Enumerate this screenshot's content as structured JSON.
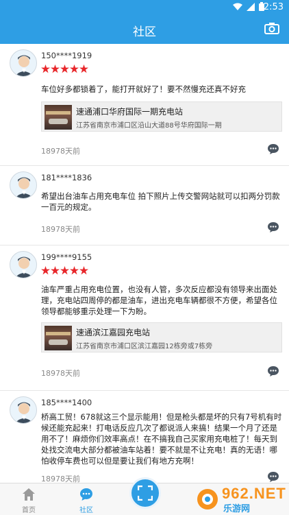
{
  "status_bar": {
    "time": "2:53"
  },
  "app_bar": {
    "title": "社区"
  },
  "posts": [
    {
      "user": "150****1919",
      "rating": 5,
      "content": "车位好多都锁着了，能打开就好了！要不然慢充还真不好充",
      "station": {
        "name": "速通浦口华府国际一期充电站",
        "address": "江苏省南京市浦口区沿山大道88号华府国际一期"
      },
      "time": "18978天前"
    },
    {
      "user": "181****1836",
      "rating": 0,
      "content": "希望出台油车占用充电车位 拍下照片上传交警网站就可以扣两分罚款一百元的规定。",
      "station": null,
      "time": "18978天前"
    },
    {
      "user": "199****9155",
      "rating": 5,
      "content": "油车严重占用充电位置，也没有人管，多次反应都没有领导来出面处理，充电站四周停的都是油车，进出充电车辆都很不方便，希望各位领导都能够重示处理一下为盼。",
      "station": {
        "name": "速通滨江嘉园充电站",
        "address": "江苏省南京市浦口区滨江嘉园12栋旁或7栋旁"
      },
      "time": "18978天前"
    },
    {
      "user": "185****1400",
      "rating": 0,
      "content": "桥高工贸！678就这三个显示能用！但是枪头都是坏的只有7号机有时候还能充起来！打电话反应几次了都说派人来搞！结果一个月了还是用不了！麻烦你们效率高点！在不搞我自己买家用充电桩了！每天到处找交流电大部分都被油车站着！要不就是不让充电！真的无语！哪怕收停车费也可以但是要让我们有地方充啊！",
      "station": null,
      "time": "18978天前"
    }
  ],
  "bottom_nav": {
    "home": "首页",
    "community": "社区"
  },
  "watermark": {
    "brand": "962.NET",
    "sub": "乐游网"
  },
  "colors": {
    "primary": "#2e9ee4",
    "star": "#e8272b"
  }
}
